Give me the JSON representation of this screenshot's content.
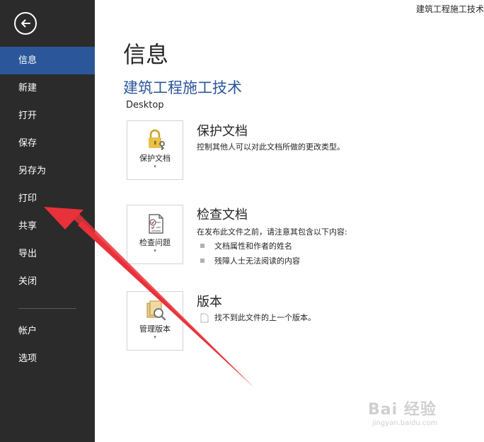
{
  "window": {
    "title": "建筑工程施工技术"
  },
  "sidebar": {
    "back_label": "back",
    "items": [
      {
        "label": "信息",
        "active": true
      },
      {
        "label": "新建"
      },
      {
        "label": "打开"
      },
      {
        "label": "保存"
      },
      {
        "label": "另存为"
      },
      {
        "label": "打印"
      },
      {
        "label": "共享"
      },
      {
        "label": "导出"
      },
      {
        "label": "关闭"
      }
    ],
    "bottom_items": [
      {
        "label": "帐户"
      },
      {
        "label": "选项"
      }
    ],
    "background": "#2b2b2b",
    "active_color": "#2b579a"
  },
  "main": {
    "page_title": "信息",
    "doc_title": "建筑工程施工技术",
    "doc_path": "Desktop",
    "protect": {
      "tile_label": "保护文档",
      "title": "保护文档",
      "description": "控制其他人可以对此文档所做的更改类型。",
      "icon": "lock-key-icon"
    },
    "inspect": {
      "tile_label": "检查问题",
      "title": "检查文档",
      "description": "在发布此文件之前，请注意其包含以下内容:",
      "bullets": [
        "文档属性和作者的姓名",
        "残障人士无法阅读的内容"
      ],
      "icon": "checklist-icon"
    },
    "versions": {
      "tile_label": "管理版本",
      "title": "版本",
      "description": "找不到此文件的上一个版本。",
      "icon": "versions-icon"
    },
    "caret": "▾",
    "accent": "#2b579a"
  },
  "watermark": {
    "main": "Bai 经验",
    "sub": "jingyan.baidu.com"
  },
  "annotation": {
    "arrow_color": "#e8313a"
  }
}
